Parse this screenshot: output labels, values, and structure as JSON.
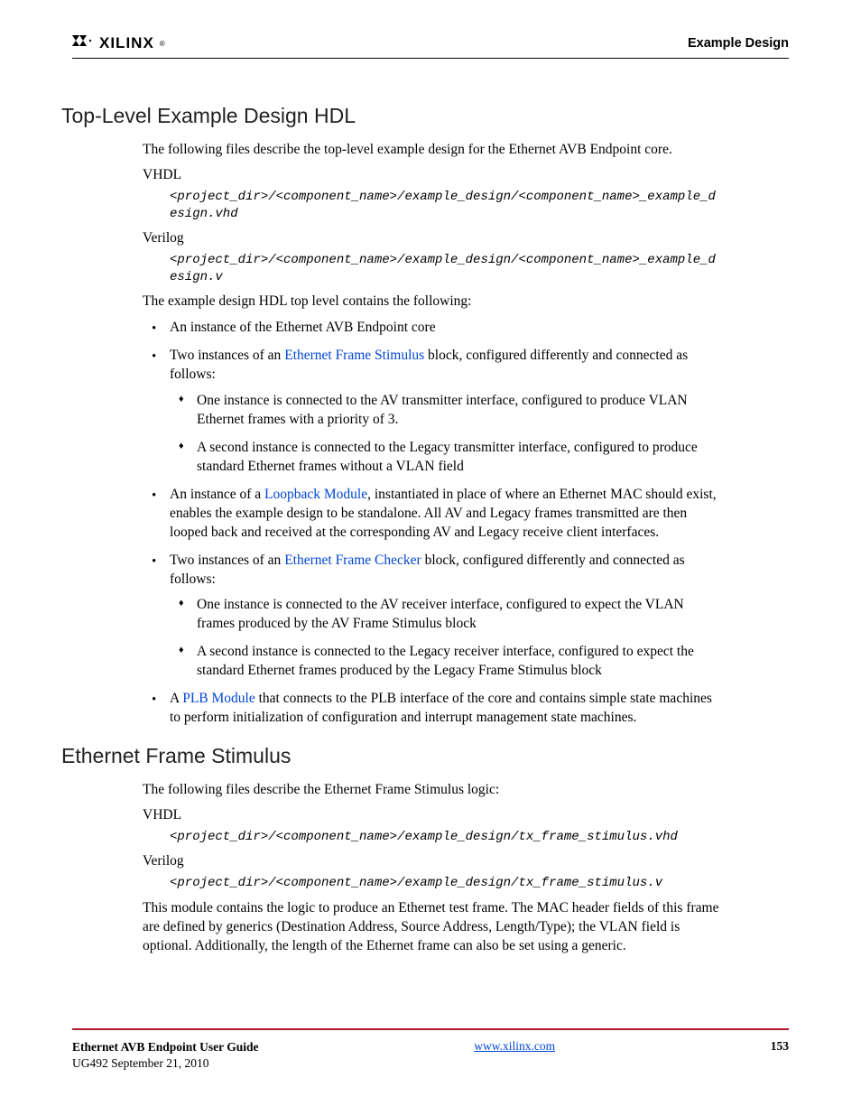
{
  "header": {
    "logo_text": "XILINX",
    "chapter": "Example Design"
  },
  "sections": {
    "s1": {
      "title": "Top-Level Example Design HDL",
      "intro": "The following files describe the top-level example design for the Ethernet AVB Endpoint core.",
      "vhdl_label": "VHDL",
      "vhdl_code": "<project_dir>/<component_name>/example_design/<component_name>_example_design.vhd",
      "verilog_label": "Verilog",
      "verilog_code": "<project_dir>/<component_name>/example_design/<component_name>_example_design.v",
      "following": "The example design HDL top level contains the following:",
      "bullets": {
        "b1": "An instance of the Ethernet AVB Endpoint core",
        "b2_pre": "Two instances of an ",
        "b2_link": "Ethernet Frame Stimulus",
        "b2_post": " block, configured differently and connected as follows:",
        "b2_sub1": "One instance is connected to the AV transmitter interface, configured to produce VLAN Ethernet frames with a priority of 3.",
        "b2_sub2": "A second instance is connected to the Legacy transmitter interface, configured to produce standard Ethernet frames without a VLAN field",
        "b3_pre": "An instance of a ",
        "b3_link": "Loopback Module",
        "b3_post": ", instantiated in place of where an Ethernet MAC should exist, enables the example design to be standalone. All AV and Legacy frames transmitted are then looped back and received at the corresponding AV and Legacy receive client interfaces.",
        "b4_pre": "Two instances of an ",
        "b4_link": "Ethernet Frame Checker",
        "b4_post": " block, configured differently and connected as follows:",
        "b4_sub1": "One instance is connected to the AV receiver interface, configured to expect the VLAN frames produced by the AV Frame Stimulus block",
        "b4_sub2": "A second instance is connected to the Legacy receiver interface, configured to expect the standard Ethernet frames produced by the Legacy Frame Stimulus block",
        "b5_pre": "A ",
        "b5_link": "PLB Module",
        "b5_post": " that connects to the PLB interface of the core and contains simple state machines to perform initialization of configuration and interrupt management state machines."
      }
    },
    "s2": {
      "title": "Ethernet Frame Stimulus",
      "intro": "The following files describe the Ethernet Frame Stimulus logic:",
      "vhdl_label": "VHDL",
      "vhdl_code": "<project_dir>/<component_name>/example_design/tx_frame_stimulus.vhd",
      "verilog_label": "Verilog",
      "verilog_code": "<project_dir>/<component_name>/example_design/tx_frame_stimulus.v",
      "desc": "This module contains the logic to produce an Ethernet test frame. The MAC header fields of this frame are defined by generics (Destination Address, Source Address, Length/Type); the VLAN field is optional. Additionally, the length of the Ethernet frame can also be set using a generic."
    }
  },
  "footer": {
    "title": "Ethernet AVB Endpoint User Guide",
    "doc": "UG492 September 21, 2010",
    "url": "www.xilinx.com",
    "page": "153"
  }
}
